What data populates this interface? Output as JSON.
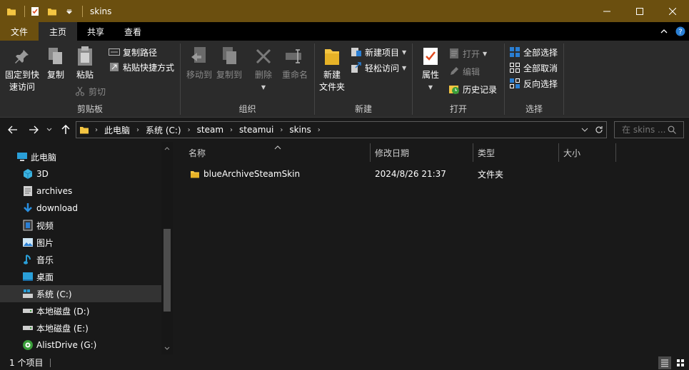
{
  "window": {
    "title": "skins"
  },
  "ribbon_tabs": [
    {
      "label": "文件"
    },
    {
      "label": "主页"
    },
    {
      "label": "共享"
    },
    {
      "label": "查看"
    }
  ],
  "ribbon": {
    "clipboard": {
      "group_label": "剪贴板",
      "pin_label_1": "固定到快",
      "pin_label_2": "速访问",
      "copy": "复制",
      "paste": "粘贴",
      "copy_path": "复制路径",
      "paste_shortcut": "粘贴快捷方式",
      "cut": "剪切"
    },
    "organize": {
      "group_label": "组织",
      "move_to": "移动到",
      "copy_to": "复制到",
      "delete": "删除",
      "rename": "重命名"
    },
    "new": {
      "group_label": "新建",
      "new_folder_1": "新建",
      "new_folder_2": "文件夹",
      "new_item": "新建项目",
      "easy_access": "轻松访问"
    },
    "open": {
      "group_label": "打开",
      "properties": "属性",
      "open": "打开",
      "edit": "编辑",
      "history": "历史记录"
    },
    "select": {
      "group_label": "选择",
      "select_all": "全部选择",
      "select_none": "全部取消",
      "invert": "反向选择"
    }
  },
  "address": {
    "crumbs": [
      "此电脑",
      "系统 (C:)",
      "steam",
      "steamui",
      "skins"
    ],
    "search_placeholder": "在 skins ..."
  },
  "nav_tree": [
    {
      "label": "此电脑",
      "icon": "computer-icon"
    },
    {
      "label": "3D",
      "icon": "3d-objects-icon"
    },
    {
      "label": "archives",
      "icon": "document-folder-icon"
    },
    {
      "label": "download",
      "icon": "download-arrow-icon"
    },
    {
      "label": "视频",
      "icon": "video-icon"
    },
    {
      "label": "图片",
      "icon": "picture-icon"
    },
    {
      "label": "音乐",
      "icon": "music-note-icon"
    },
    {
      "label": "桌面",
      "icon": "desktop-icon"
    },
    {
      "label": "系统 (C:)",
      "icon": "system-drive-icon"
    },
    {
      "label": "本地磁盘 (D:)",
      "icon": "drive-icon"
    },
    {
      "label": "本地磁盘 (E:)",
      "icon": "drive-icon"
    },
    {
      "label": "AlistDrive (G:)",
      "icon": "network-drive-icon"
    }
  ],
  "columns": {
    "name": "名称",
    "modified": "修改日期",
    "type": "类型",
    "size": "大小"
  },
  "files": [
    {
      "name": "blueArchiveSteamSkin",
      "modified": "2024/8/26 21:37",
      "type": "文件夹",
      "size": ""
    }
  ],
  "status": {
    "count": "1 个项目"
  },
  "colors": {
    "titlebar": "#6b4f0f",
    "folder": "#f4c542",
    "background": "#191919",
    "ribbon": "#2b2b2b"
  }
}
